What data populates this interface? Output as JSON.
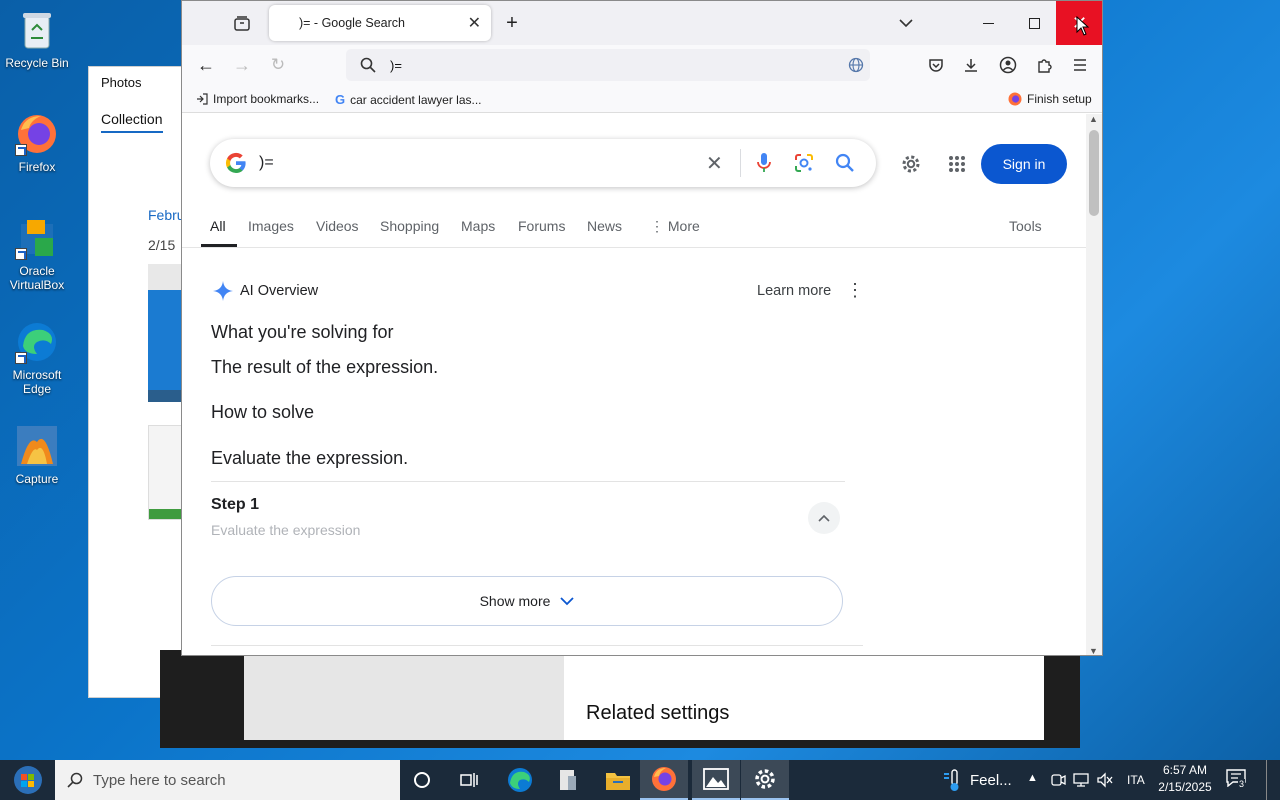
{
  "desktop": {
    "icons": [
      {
        "label": "Recycle Bin",
        "icon": "recycle-bin-icon"
      },
      {
        "label": "Firefox",
        "icon": "firefox-icon"
      },
      {
        "label": "Oracle VirtualBox",
        "icon": "virtualbox-icon"
      },
      {
        "label": "Microsoft Edge",
        "icon": "edge-icon"
      },
      {
        "label": "Capture",
        "icon": "capture-icon"
      }
    ]
  },
  "photos_window": {
    "title": "Photos",
    "tab": "Collection",
    "month": "Febru",
    "date": "2/15"
  },
  "settings_window": {
    "related": "Related settings"
  },
  "browser": {
    "tab_title": ")= - Google Search",
    "url_text": ")=",
    "bookmarks": [
      {
        "label": "Import bookmarks..."
      },
      {
        "label": "car accident lawyer las..."
      }
    ],
    "finish_setup": "Finish setup"
  },
  "google": {
    "query": ")=",
    "sign_in": "Sign in",
    "tabs": [
      "All",
      "Images",
      "Videos",
      "Shopping",
      "Maps",
      "Forums",
      "News",
      "More"
    ],
    "tools": "Tools",
    "ai_overview": {
      "title": "AI Overview",
      "learn_more": "Learn more",
      "solving_heading": "What you're solving for",
      "solving_text": "The result of the expression.",
      "how_heading": "How to solve",
      "how_text": "Evaluate the expression.",
      "step_title": "Step 1",
      "step_text": "Evaluate the expression",
      "show_more": "Show more"
    },
    "colors": {
      "accent": "#0b57d0",
      "text": "#202124"
    }
  },
  "taskbar": {
    "search_placeholder": "Type here to search",
    "weather": "Feel...",
    "language": "ITA",
    "time": "6:57 AM",
    "date": "2/15/2025",
    "notifications": "3"
  }
}
